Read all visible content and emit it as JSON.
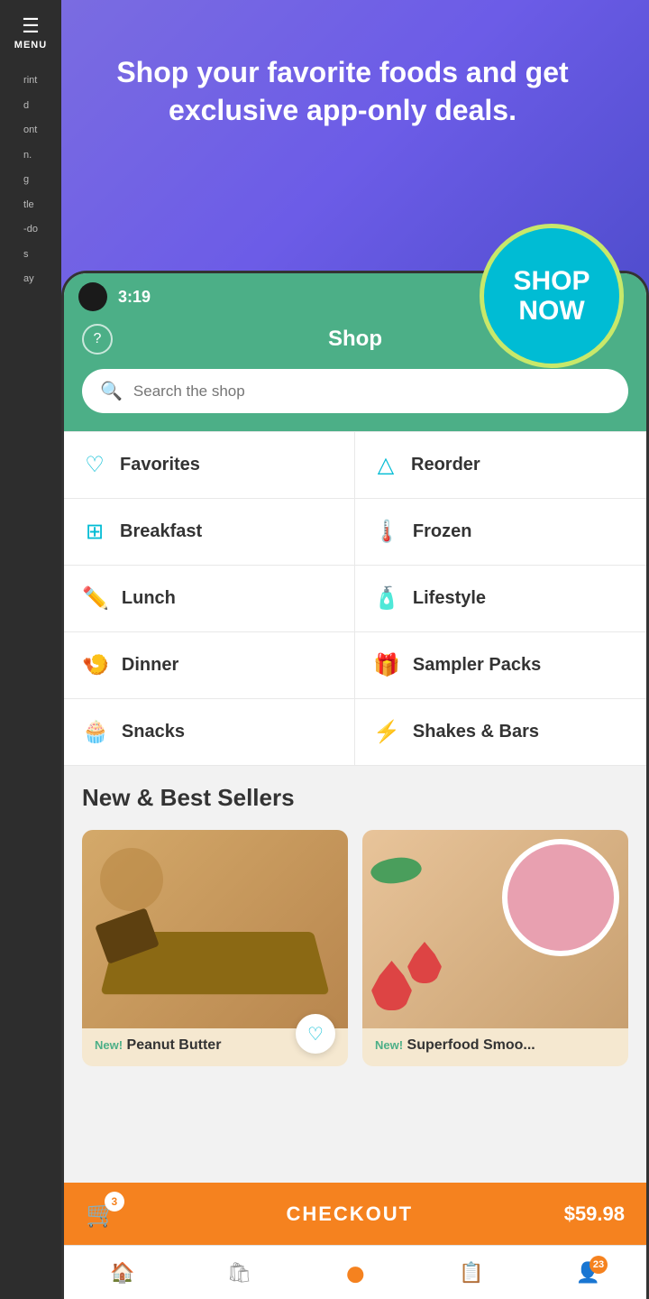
{
  "promo": {
    "headline": "Shop your favorite foods and get exclusive app-only deals.",
    "shop_now": "SHOP\nNOW"
  },
  "status_bar": {
    "time": "3:19"
  },
  "header": {
    "title": "Shop",
    "help_icon": "?"
  },
  "search": {
    "placeholder": "Search the shop"
  },
  "categories": [
    {
      "id": "favorites",
      "label": "Favorites",
      "icon": "♡"
    },
    {
      "id": "reorder",
      "label": "Reorder",
      "icon": "△"
    },
    {
      "id": "breakfast",
      "label": "Breakfast",
      "icon": "⊞"
    },
    {
      "id": "frozen",
      "label": "Frozen",
      "icon": "🌡"
    },
    {
      "id": "lunch",
      "label": "Lunch",
      "icon": "✏"
    },
    {
      "id": "lifestyle",
      "label": "Lifestyle",
      "icon": "🧴"
    },
    {
      "id": "dinner",
      "label": "Dinner",
      "icon": "🍤"
    },
    {
      "id": "sampler-packs",
      "label": "Sampler Packs",
      "icon": "🎁"
    },
    {
      "id": "snacks",
      "label": "Snacks",
      "icon": "🧁"
    },
    {
      "id": "shakes-bars",
      "label": "Shakes & Bars",
      "icon": "⚡"
    }
  ],
  "section": {
    "title": "New & Best Sellers"
  },
  "products": [
    {
      "id": "peanut-butter",
      "badge": "New!",
      "name": "Peanut Butter"
    },
    {
      "id": "superfood-smoothie",
      "badge": "New!",
      "name": "Superfood Smoo..."
    }
  ],
  "checkout": {
    "label": "CHECKOUT",
    "price": "$59.98",
    "cart_count": "3"
  },
  "bottom_nav": [
    {
      "icon": "🏠",
      "label": "Home"
    },
    {
      "icon": "🛍",
      "label": "Shop"
    },
    {
      "icon": "⭕",
      "label": "Center",
      "badge": null,
      "is_center": true
    },
    {
      "icon": "📋",
      "label": "Plan"
    },
    {
      "icon": "👤",
      "label": "Profile",
      "badge": "23"
    }
  ],
  "sidebar": {
    "menu_label": "MENU",
    "side_texts": [
      "rint",
      "d",
      "ont",
      "n.",
      "g"
    ]
  }
}
